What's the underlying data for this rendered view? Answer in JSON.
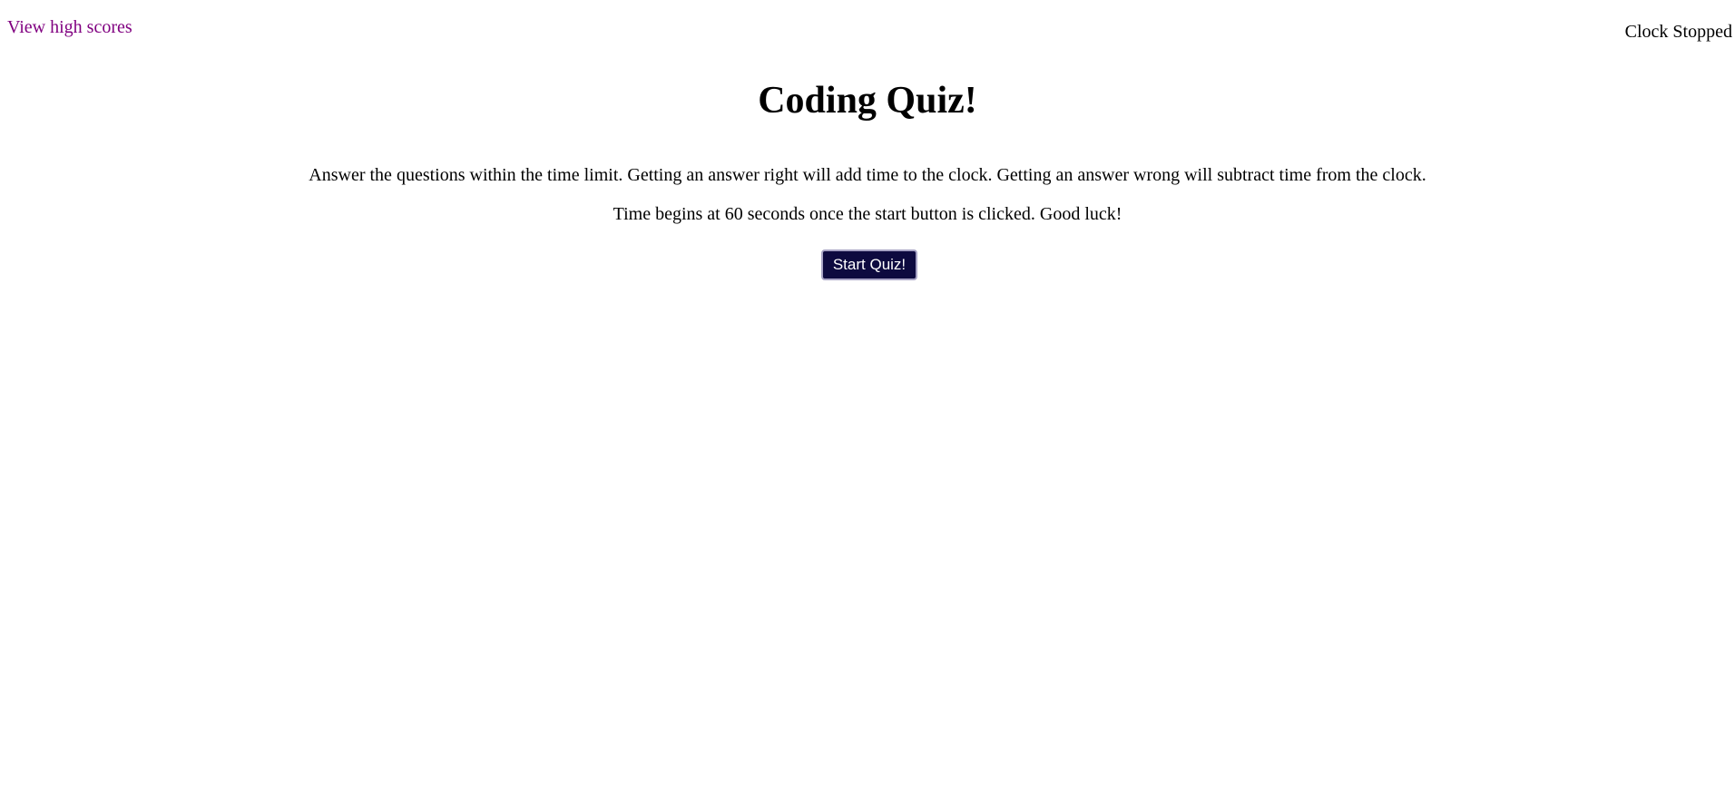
{
  "header": {
    "high_scores_link": "View high scores",
    "clock_status": "Clock Stopped"
  },
  "main": {
    "title": "Coding Quiz!",
    "instructions": [
      "Answer the questions within the time limit. Getting an answer right will add time to the clock. Getting an answer wrong will subtract time from the clock.",
      "Time begins at 60 seconds once the start button is clicked. Good luck!"
    ],
    "start_button_label": "Start Quiz!"
  },
  "colors": {
    "link": "#800080",
    "button_background": "#0d0a3f",
    "button_text": "#ffffff",
    "page_background": "#ffffff"
  }
}
